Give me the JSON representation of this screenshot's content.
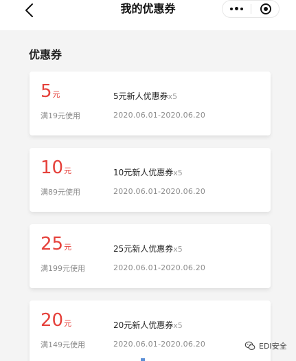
{
  "nav": {
    "title": "我的优惠券",
    "back_icon": "chevron-left-icon",
    "more_icon": "more-dots-icon",
    "close_icon": "target-circle-icon"
  },
  "section": {
    "title": "优惠券"
  },
  "colors": {
    "accent": "#e5413b",
    "background": "#f4f4f4",
    "card": "#ffffff"
  },
  "coupons": [
    {
      "amount": "5",
      "unit": "元",
      "condition": "满19元使用",
      "name": "5元新人优惠券",
      "qty": "x5",
      "validity": "2020.06.01-2020.06.20"
    },
    {
      "amount": "10",
      "unit": "元",
      "condition": "满89元使用",
      "name": "10元新人优惠券",
      "qty": "x5",
      "validity": "2020.06.01-2020.06.20"
    },
    {
      "amount": "25",
      "unit": "元",
      "condition": "满199元使用",
      "name": "25元新人优惠券",
      "qty": "x5",
      "validity": "2020.06.01-2020.06.20"
    },
    {
      "amount": "20",
      "unit": "元",
      "condition": "满149元使用",
      "name": "20元新人优惠券",
      "qty": "x5",
      "validity": "2020.06.01-2020.06.20"
    }
  ],
  "watermark": {
    "text": "EDI安全",
    "icon": "wechat-logo-icon"
  }
}
